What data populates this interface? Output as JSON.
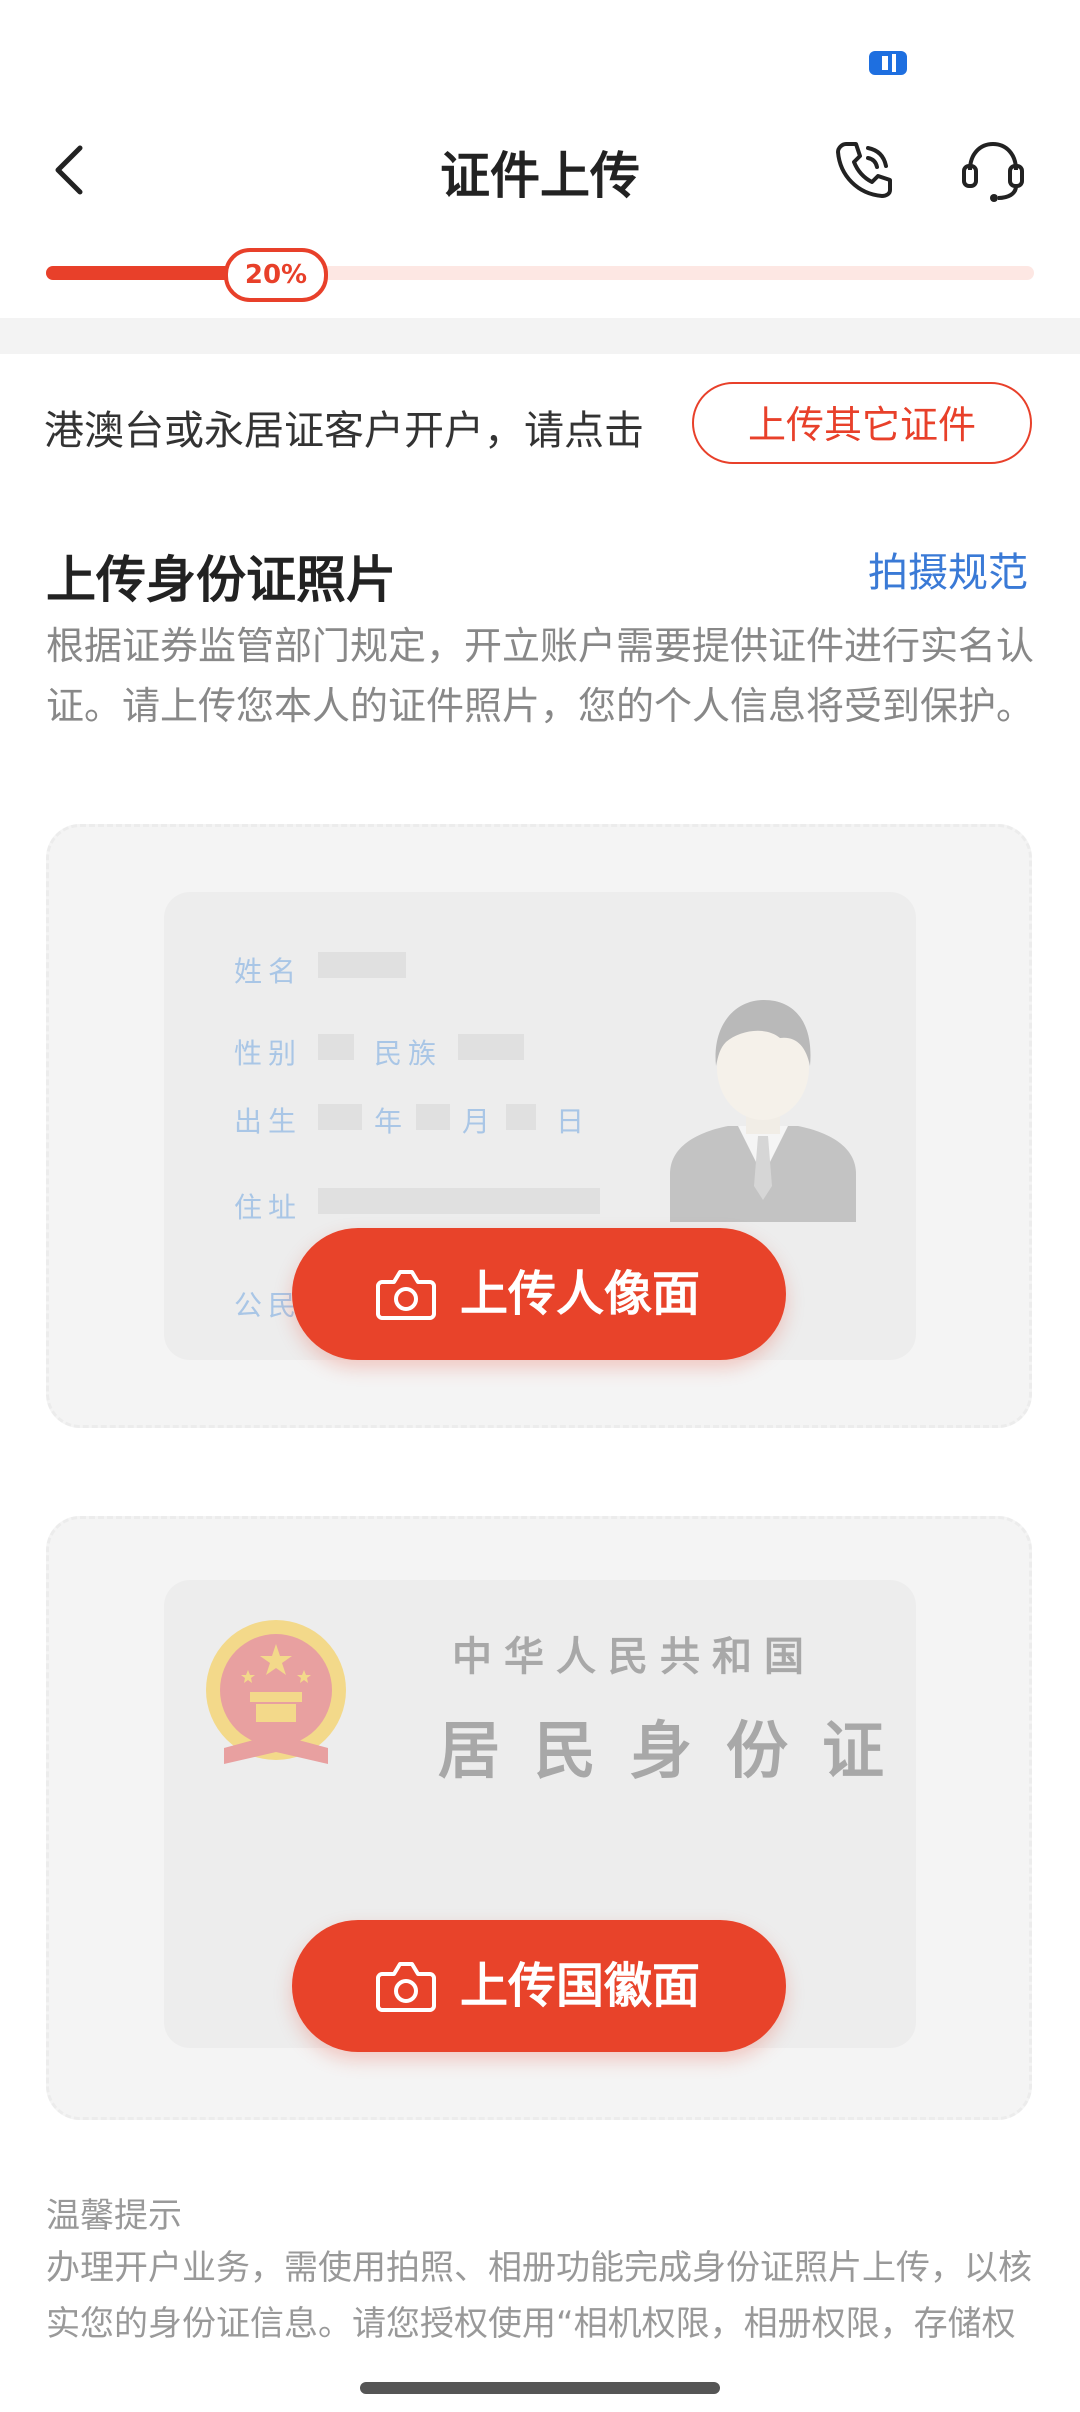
{
  "header": {
    "title": "证件上传",
    "back_icon": "chevron-left-icon",
    "phone_icon": "phone-icon",
    "service_icon": "headset-icon"
  },
  "progress": {
    "label": "20%",
    "value": 0.2
  },
  "other_cert": {
    "text": "港澳台或永居证客户开户，请点击",
    "button": "上传其它证件"
  },
  "section": {
    "title": "上传身份证照片",
    "link": "拍摄规范",
    "desc": "根据证券监管部门规定，开立账户需要提供证件进行实名认证。请上传您本人的证件照片，您的个人信息将受到保护。"
  },
  "id_front": {
    "name_label": "姓名",
    "gender_label": "性别",
    "ethnic_label": "民族",
    "birth_label": "出生",
    "year_label": "年",
    "month_label": "月",
    "day_label": "日",
    "address_label": "住址",
    "citizen_label": "公民",
    "button": "上传人像面"
  },
  "id_back": {
    "line1": "中华人民共和国",
    "line2": "居民身份证",
    "button": "上传国徽面"
  },
  "tips": {
    "title": "温馨提示",
    "text": "办理开户业务，需使用拍照、相册功能完成身份证照片上传，以核实您的身份证信息。请您授权使用“相机权限，相册权限，存储权限”如您拒绝授权将无法体验上述服务，但不影响您使用其他功"
  },
  "colors": {
    "accent": "#e8402a",
    "link": "#3a7ad6"
  }
}
